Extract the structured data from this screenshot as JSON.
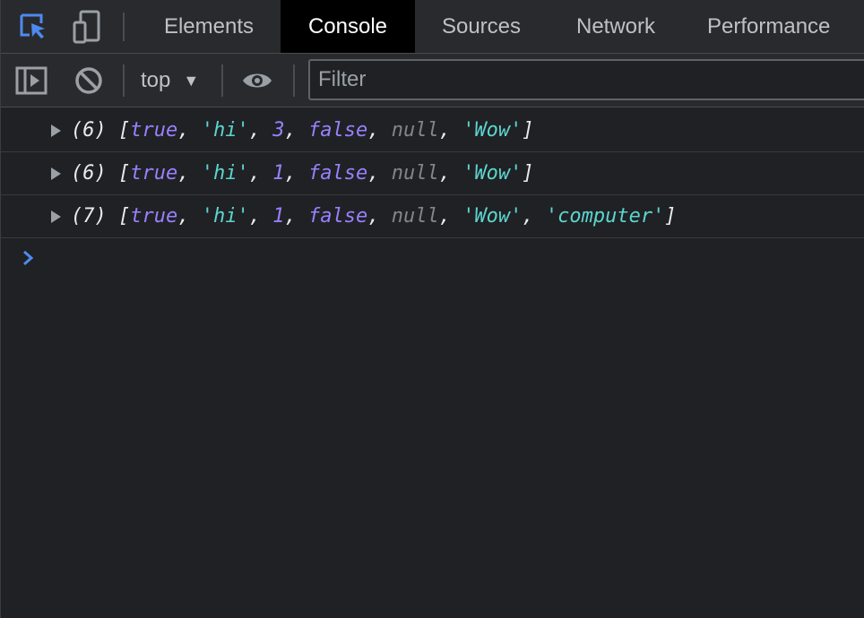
{
  "tabs": [
    {
      "label": "Elements"
    },
    {
      "label": "Console"
    },
    {
      "label": "Sources"
    },
    {
      "label": "Network"
    },
    {
      "label": "Performance"
    }
  ],
  "toolbar": {
    "context": "top",
    "filter_placeholder": "Filter"
  },
  "console": {
    "entries": [
      {
        "count": "(6)",
        "tokens": [
          {
            "t": "punc",
            "v": "["
          },
          {
            "t": "bool",
            "v": "true"
          },
          {
            "t": "punc",
            "v": ", "
          },
          {
            "t": "str",
            "v": "'hi'"
          },
          {
            "t": "punc",
            "v": ", "
          },
          {
            "t": "num",
            "v": "3"
          },
          {
            "t": "punc",
            "v": ", "
          },
          {
            "t": "bool",
            "v": "false"
          },
          {
            "t": "punc",
            "v": ", "
          },
          {
            "t": "null",
            "v": "null"
          },
          {
            "t": "punc",
            "v": ", "
          },
          {
            "t": "str",
            "v": "'Wow'"
          },
          {
            "t": "punc",
            "v": "]"
          }
        ]
      },
      {
        "count": "(6)",
        "tokens": [
          {
            "t": "punc",
            "v": "["
          },
          {
            "t": "bool",
            "v": "true"
          },
          {
            "t": "punc",
            "v": ", "
          },
          {
            "t": "str",
            "v": "'hi'"
          },
          {
            "t": "punc",
            "v": ", "
          },
          {
            "t": "num",
            "v": "1"
          },
          {
            "t": "punc",
            "v": ", "
          },
          {
            "t": "bool",
            "v": "false"
          },
          {
            "t": "punc",
            "v": ", "
          },
          {
            "t": "null",
            "v": "null"
          },
          {
            "t": "punc",
            "v": ", "
          },
          {
            "t": "str",
            "v": "'Wow'"
          },
          {
            "t": "punc",
            "v": "]"
          }
        ]
      },
      {
        "count": "(7)",
        "tokens": [
          {
            "t": "punc",
            "v": "["
          },
          {
            "t": "bool",
            "v": "true"
          },
          {
            "t": "punc",
            "v": ", "
          },
          {
            "t": "str",
            "v": "'hi'"
          },
          {
            "t": "punc",
            "v": ", "
          },
          {
            "t": "num",
            "v": "1"
          },
          {
            "t": "punc",
            "v": ", "
          },
          {
            "t": "bool",
            "v": "false"
          },
          {
            "t": "punc",
            "v": ", "
          },
          {
            "t": "null",
            "v": "null"
          },
          {
            "t": "punc",
            "v": ", "
          },
          {
            "t": "str",
            "v": "'Wow'"
          },
          {
            "t": "punc",
            "v": ", "
          },
          {
            "t": "str",
            "v": "'computer'"
          },
          {
            "t": "punc",
            "v": "]"
          }
        ]
      }
    ]
  },
  "colors": {
    "background": "#202124",
    "toolbar": "#292a2d",
    "active_tab": "#000000",
    "accent": "#4d8af0",
    "boolean": "#9980ff",
    "string": "#5cd5d0",
    "null": "#80868b"
  },
  "icons": [
    "inspect-element-icon",
    "device-toolbar-icon",
    "sidebar-toggle-icon",
    "clear-console-icon",
    "live-expression-icon",
    "prompt-chevron-icon",
    "expand-arrow-icon"
  ]
}
